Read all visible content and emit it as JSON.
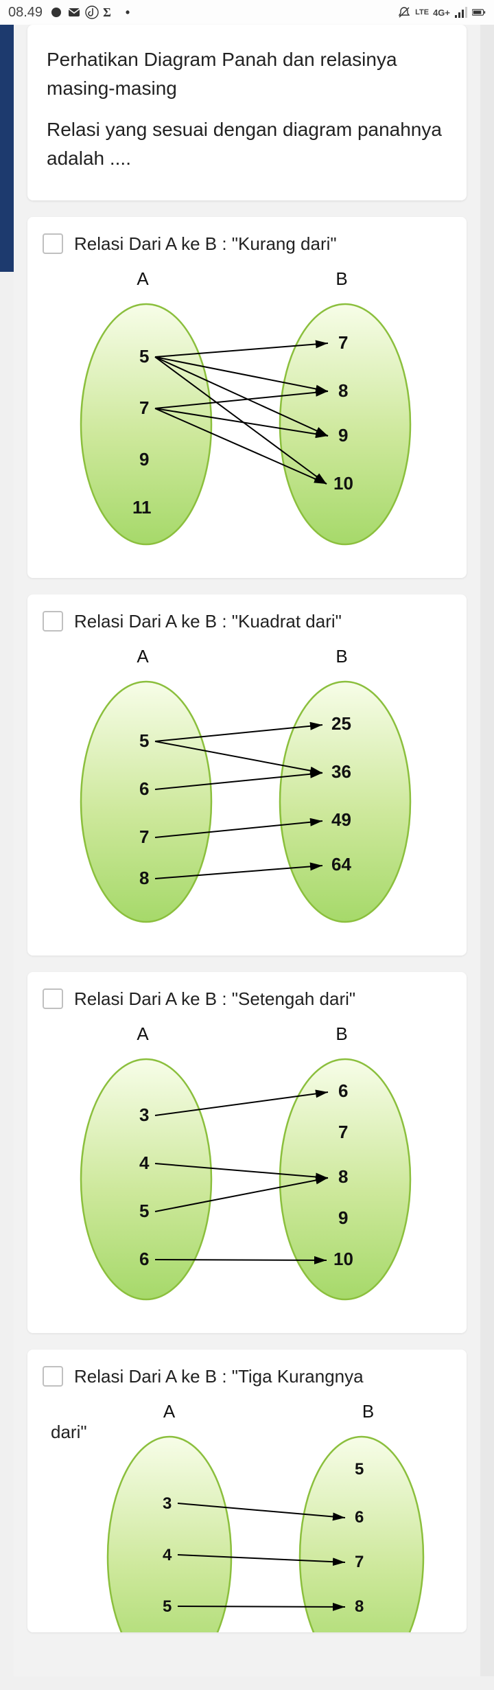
{
  "statusbar": {
    "time": "08.49",
    "net_label": "4G+",
    "lte_label": "LTE"
  },
  "question": {
    "line1": "Perhatikan Diagram Panah dan relasinya masing-masing",
    "line2": "Relasi yang sesuai dengan diagram panahnya adalah ...."
  },
  "set_labels": {
    "A": "A",
    "B": "B"
  },
  "options": [
    {
      "label": "Relasi Dari A ke B : \"Kurang dari\""
    },
    {
      "label": "Relasi Dari A ke B : \"Kuadrat dari\""
    },
    {
      "label": "Relasi Dari A ke B : \"Setengah dari\""
    },
    {
      "label": "Relasi Dari A ke B : \"Tiga Kurangnya"
    }
  ],
  "dari_suffix": "dari\"",
  "chart_data": [
    {
      "type": "mapping",
      "title": "Relasi Dari A ke B : \"Kurang dari\"",
      "domain_label": "A",
      "codomain_label": "B",
      "domain": [
        5,
        7,
        9,
        11
      ],
      "codomain": [
        7,
        8,
        9,
        10
      ],
      "edges": [
        [
          5,
          7
        ],
        [
          5,
          8
        ],
        [
          5,
          9
        ],
        [
          5,
          10
        ],
        [
          7,
          8
        ],
        [
          7,
          9
        ],
        [
          7,
          10
        ]
      ]
    },
    {
      "type": "mapping",
      "title": "Relasi Dari A ke B : \"Kuadrat dari\"",
      "domain_label": "A",
      "codomain_label": "B",
      "domain": [
        5,
        6,
        7,
        8
      ],
      "codomain": [
        25,
        36,
        49,
        64
      ],
      "edges": [
        [
          5,
          25
        ],
        [
          5,
          36
        ],
        [
          6,
          36
        ],
        [
          7,
          49
        ],
        [
          8,
          64
        ]
      ]
    },
    {
      "type": "mapping",
      "title": "Relasi Dari A ke B : \"Setengah dari\"",
      "domain_label": "A",
      "codomain_label": "B",
      "domain": [
        3,
        4,
        5,
        6
      ],
      "codomain": [
        6,
        7,
        8,
        9,
        10
      ],
      "edges": [
        [
          3,
          6
        ],
        [
          4,
          8
        ],
        [
          5,
          8
        ],
        [
          6,
          10
        ]
      ]
    },
    {
      "type": "mapping",
      "title": "Relasi Dari A ke B : \"Tiga Kurangnya dari\"",
      "domain_label": "A",
      "codomain_label": "B",
      "domain": [
        3,
        4,
        5
      ],
      "codomain": [
        5,
        6,
        7,
        8
      ],
      "edges": [
        [
          3,
          6
        ],
        [
          4,
          7
        ],
        [
          5,
          8
        ]
      ],
      "note": "partially visible (cropped at bottom)"
    }
  ]
}
